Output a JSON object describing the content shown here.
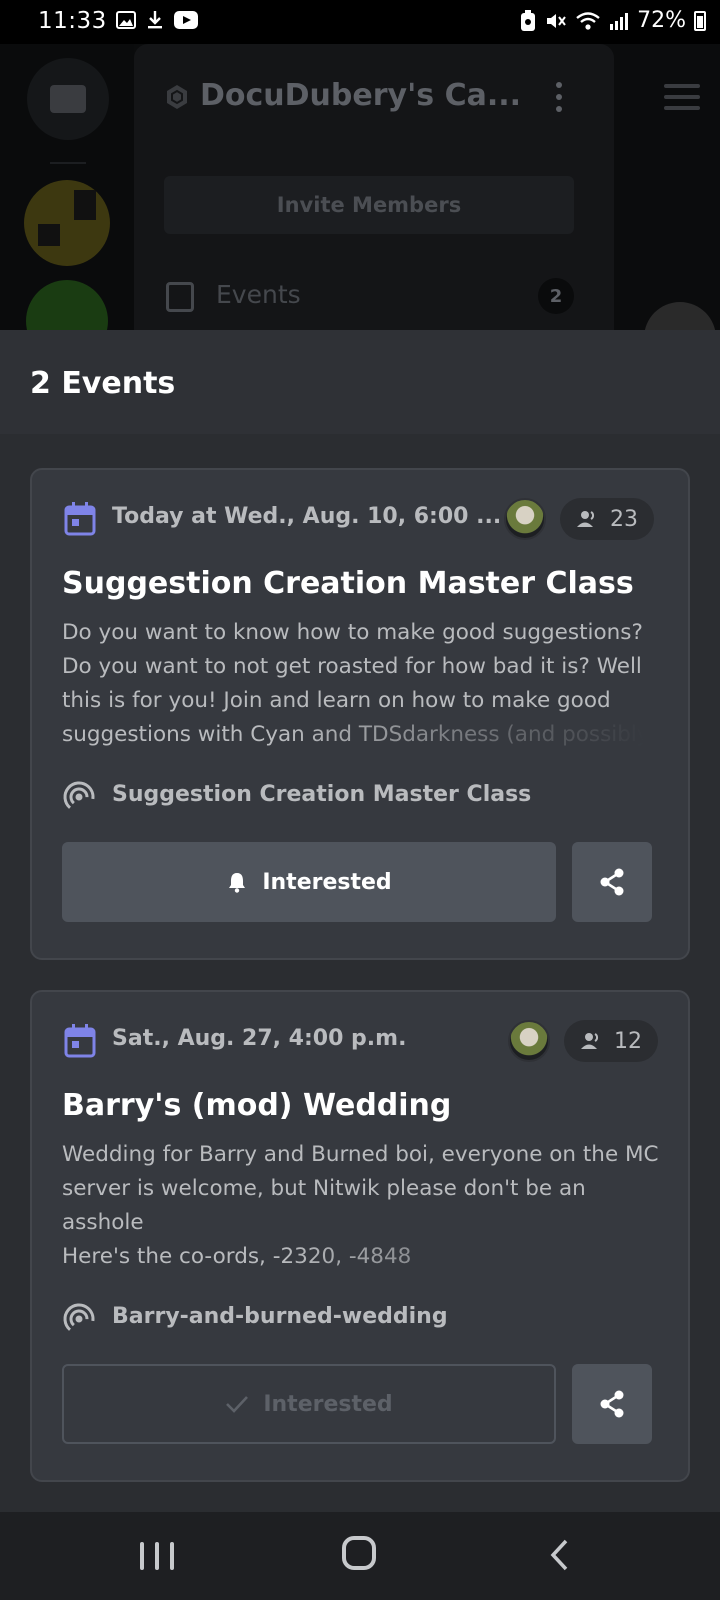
{
  "status_bar": {
    "time": "11:33",
    "battery": "72%",
    "left_icons": [
      "gallery-icon",
      "download-icon",
      "youtube-icon"
    ],
    "right_icons": [
      "data-saver-icon",
      "mute-icon",
      "wifi-icon",
      "signal-icon",
      "battery-icon"
    ]
  },
  "background_app": {
    "server_title": "DocuDubery's Ca...",
    "invite_label": "Invite Members",
    "events_label": "Events",
    "events_count": "2"
  },
  "sheet": {
    "title": "2 Events",
    "events": [
      {
        "date": "Today at Wed., Aug. 10, 6:00 ...",
        "interested_count": "23",
        "title": "Suggestion Creation Master Class",
        "description": "Do you want to know how to make good suggestions? Do you want to not get roasted for how bad it is? Well this is for you! Join and learn on how to make good suggestions with Cyan and TDSdarkness (and possibly",
        "location": "Suggestion Creation Master Class",
        "interested_label": "Interested",
        "interested_state": "not-interested"
      },
      {
        "date": "Sat., Aug. 27, 4:00 p.m.",
        "interested_count": "12",
        "title": "Barry's (mod) Wedding",
        "description_lines": [
          "Wedding for Barry and Burned boi, everyone on the MC server is welcome, but Nitwik please don't be an asshole",
          "Here's the co-ords, -2320, -4848"
        ],
        "location": "Barry-and-burned-wedding",
        "interested_label": "Interested",
        "interested_state": "interested"
      }
    ]
  },
  "colors": {
    "accent_calendar": "#7f84e8",
    "sheet_bg": "#2f3136",
    "card_bg": "#36393f",
    "button_bg": "#4f545c"
  }
}
